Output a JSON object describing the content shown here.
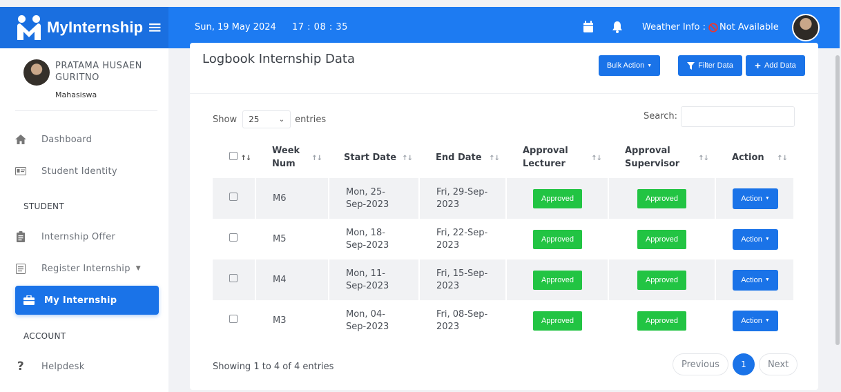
{
  "brand": {
    "name": "MyInternship"
  },
  "navbar": {
    "date": "Sun, 19 May 2024",
    "time": "17 : 08 : 35",
    "weather_label": "Weather Info :",
    "weather_value": "Not Available"
  },
  "profile": {
    "name": "PRATAMA HUSAEN GURITNO",
    "role": "Mahasiswa"
  },
  "sidebar": {
    "items": [
      {
        "label": "Dashboard",
        "icon": "home-icon"
      },
      {
        "label": "Student Identity",
        "icon": "id-card-icon"
      },
      {
        "label": "Internship Offer",
        "icon": "clipboard-icon"
      },
      {
        "label": "Register Internship",
        "icon": "form-icon"
      },
      {
        "label": "My Internship",
        "icon": "briefcase-icon"
      },
      {
        "label": "Helpdesk",
        "icon": "question-icon"
      }
    ],
    "sections": {
      "student": "STUDENT",
      "account": "ACCOUNT"
    }
  },
  "page": {
    "title": "Logbook Internship Data",
    "buttons": {
      "bulk": "Bulk Action",
      "filter": "Filter Data",
      "add": "Add Data"
    }
  },
  "table_controls": {
    "show_label": "Show",
    "show_value": "25",
    "entries_label": "entries",
    "search_label": "Search:"
  },
  "table": {
    "headers": [
      "Week Num",
      "Start Date",
      "End Date",
      "Approval Lecturer",
      "Approval Supervisor",
      "Action"
    ],
    "rows": [
      {
        "week": "M6",
        "start": "Mon, 25-Sep-2023",
        "end": "Fri, 29-Sep-2023",
        "lecturer": "Approved",
        "supervisor": "Approved",
        "action": "Action"
      },
      {
        "week": "M5",
        "start": "Mon, 18-Sep-2023",
        "end": "Fri, 22-Sep-2023",
        "lecturer": "Approved",
        "supervisor": "Approved",
        "action": "Action"
      },
      {
        "week": "M4",
        "start": "Mon, 11-Sep-2023",
        "end": "Fri, 15-Sep-2023",
        "lecturer": "Approved",
        "supervisor": "Approved",
        "action": "Action"
      },
      {
        "week": "M3",
        "start": "Mon, 04-Sep-2023",
        "end": "Fri, 08-Sep-2023",
        "lecturer": "Approved",
        "supervisor": "Approved",
        "action": "Action"
      }
    ]
  },
  "footer": {
    "info": "Showing 1 to 4 of 4 entries",
    "previous": "Previous",
    "page": "1",
    "next": "Next"
  },
  "colors": {
    "primary": "#1d7bf2",
    "brand_dark": "#1a6fe0",
    "approved": "#22c443"
  }
}
